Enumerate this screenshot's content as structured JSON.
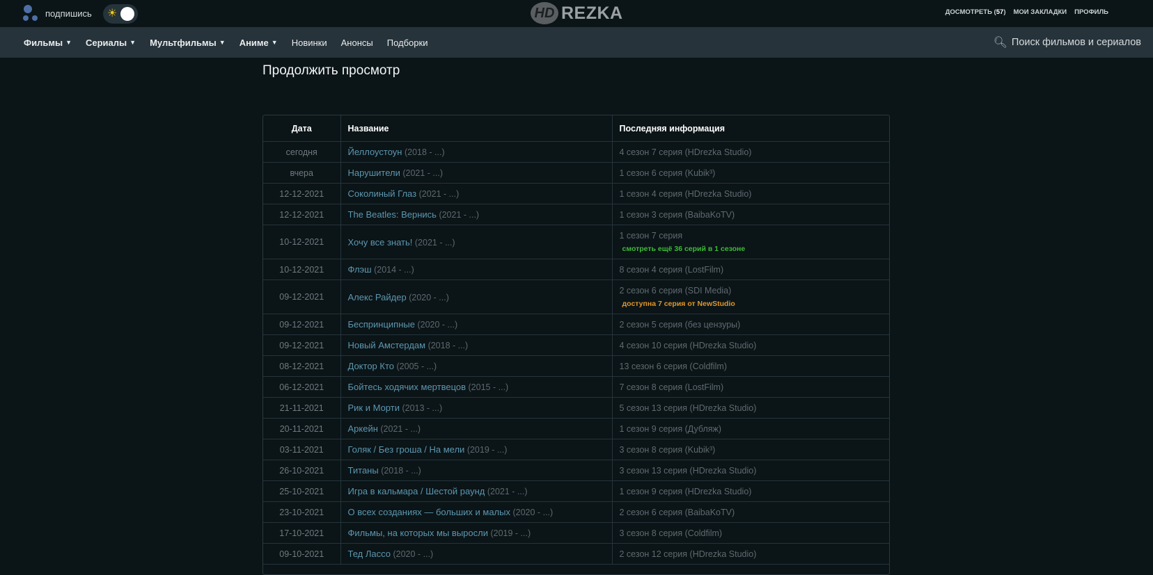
{
  "topbar": {
    "subscribe_label": "подпишись",
    "logo": {
      "hd": "HD",
      "name": "REZKA"
    },
    "links": {
      "continue_label": "ДОСМОТРЕТЬ",
      "continue_count": "57",
      "bookmarks_label": "МОИ ЗАКЛАДКИ",
      "profile_label": "ПРОФИЛЬ"
    }
  },
  "nav": {
    "items": [
      {
        "label": "Фильмы"
      },
      {
        "label": "Сериалы"
      },
      {
        "label": "Мультфильмы"
      },
      {
        "label": "Аниме"
      },
      {
        "label": "Новинки"
      },
      {
        "label": "Анонсы"
      },
      {
        "label": "Подборки"
      }
    ],
    "search_placeholder": "Поиск фильмов и сериалов"
  },
  "page": {
    "title": "Продолжить просмотр"
  },
  "table": {
    "headers": {
      "date": "Дата",
      "name": "Название",
      "info": "Последняя информация"
    },
    "rows": [
      {
        "date": "сегодня",
        "name": "Йеллоустоун",
        "year": "(2018 - ...)",
        "info": "4 сезон 7 серия (HDrezka Studio)"
      },
      {
        "date": "вчера",
        "name": "Нарушители",
        "year": "(2021 - ...)",
        "info": "1 сезон 6 серия (Kubik³)"
      },
      {
        "date": "12-12-2021",
        "name": "Соколиный Глаз",
        "year": "(2021 - ...)",
        "info": "1 сезон 4 серия (HDrezka Studio)"
      },
      {
        "date": "12-12-2021",
        "name": "The Beatles: Вернись",
        "year": "(2021 - ...)",
        "info": "1 сезон 3 серия (BaibaKoTV)"
      },
      {
        "date": "10-12-2021",
        "name": "Хочу все знать!",
        "year": "(2021 - ...)",
        "info": "1 сезон 7 серия",
        "note": "смотреть ещё 36 серий в 1 сезоне",
        "note_color": "#3dbb3a"
      },
      {
        "date": "10-12-2021",
        "name": "Флэш",
        "year": "(2014 - ...)",
        "info": "8 сезон 4 серия (LostFilm)"
      },
      {
        "date": "09-12-2021",
        "name": "Алекс Райдер",
        "year": "(2020 - ...)",
        "info": "2 сезон 6 серия (SDI Media)",
        "note": "доступна 7 серия от NewStudio",
        "note_color": "#e0962a"
      },
      {
        "date": "09-12-2021",
        "name": "Беспринципные",
        "year": "(2020 - ...)",
        "info": "2 сезон 5 серия (без цензуры)"
      },
      {
        "date": "09-12-2021",
        "name": "Новый Амстердам",
        "year": "(2018 - ...)",
        "info": "4 сезон 10 серия (HDrezka Studio)"
      },
      {
        "date": "08-12-2021",
        "name": "Доктор Кто",
        "year": "(2005 - ...)",
        "info": "13 сезон 6 серия (Coldfilm)"
      },
      {
        "date": "06-12-2021",
        "name": "Бойтесь ходячих мертвецов",
        "year": "(2015 - ...)",
        "info": "7 сезон 8 серия (LostFilm)"
      },
      {
        "date": "21-11-2021",
        "name": "Рик и Морти",
        "year": "(2013 - ...)",
        "info": "5 сезон 13 серия (HDrezka Studio)"
      },
      {
        "date": "20-11-2021",
        "name": "Аркейн",
        "year": "(2021 - ...)",
        "info": "1 сезон 9 серия (Дубляж)"
      },
      {
        "date": "03-11-2021",
        "name": "Голяк / Без гроша / На мели",
        "year": "(2019 - ...)",
        "info": "3 сезон 8 серия (Kubik³)"
      },
      {
        "date": "26-10-2021",
        "name": "Титаны",
        "year": "(2018 - ...)",
        "info": "3 сезон 13 серия (HDrezka Studio)"
      },
      {
        "date": "25-10-2021",
        "name": "Игра в кальмара / Шестой раунд",
        "year": "(2021 - ...)",
        "info": "1 сезон 9 серия (HDrezka Studio)"
      },
      {
        "date": "23-10-2021",
        "name": "О всех созданиях — больших и малых",
        "year": "(2020 - ...)",
        "info": "2 сезон 6 серия (BaibaKoTV)"
      },
      {
        "date": "17-10-2021",
        "name": "Фильмы, на которых мы выросли",
        "year": "(2019 - ...)",
        "info": "3 сезон 8 серия (Coldfilm)"
      },
      {
        "date": "09-10-2021",
        "name": "Тед Лассо",
        "year": "(2020 - ...)",
        "info": "2 сезон 12 серия (HDrezka Studio)"
      }
    ]
  }
}
